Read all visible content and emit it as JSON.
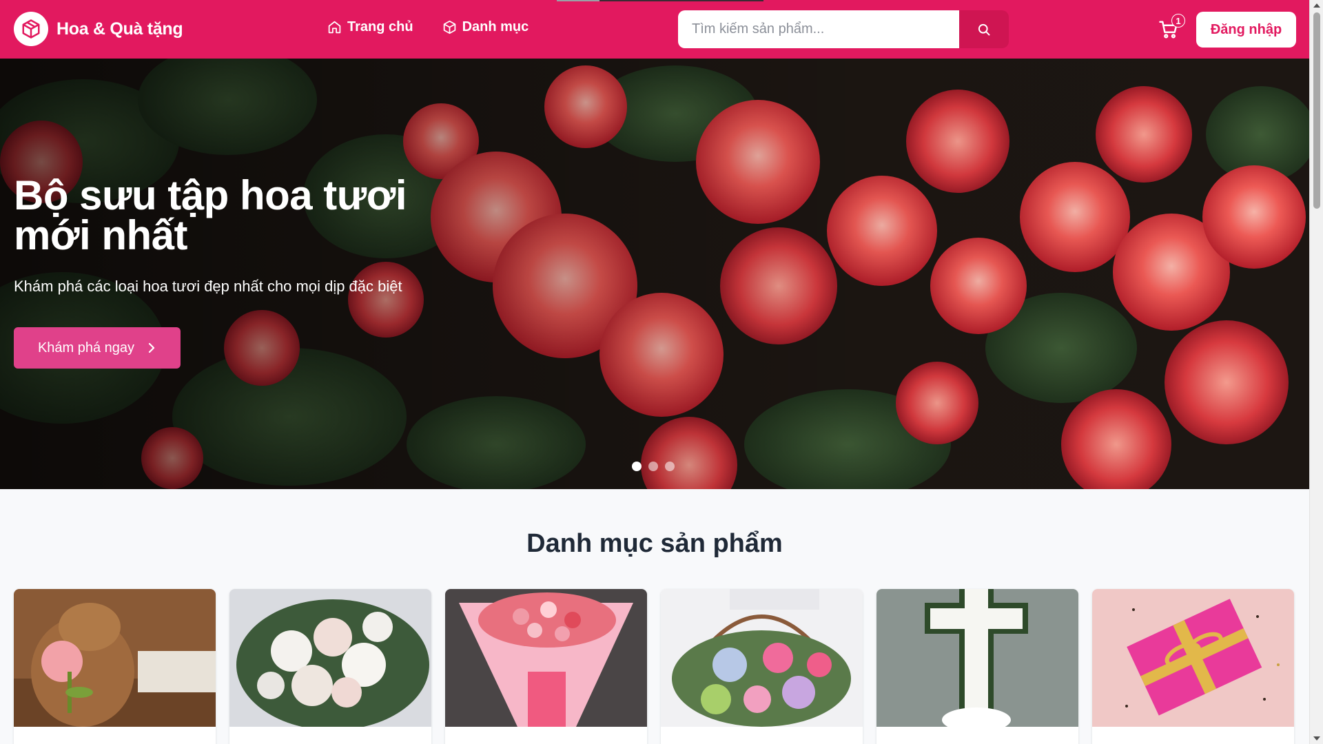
{
  "header": {
    "brand_name": "Hoa & Quà tặng",
    "nav": [
      {
        "label": "Trang chủ",
        "icon": "home-icon"
      },
      {
        "label": "Danh mục",
        "icon": "box-icon"
      }
    ],
    "search_placeholder": "Tìm kiếm sản phẩm...",
    "cart_count": "1",
    "login_label": "Đăng nhập",
    "brand_color": "#e2195f"
  },
  "hero": {
    "title": "Bộ sưu tập hoa tươi mới nhất",
    "subtitle": "Khám phá các loại hoa tươi đẹp nhất cho mọi dịp đặc biệt",
    "cta_label": "Khám phá ngay",
    "slides": 3,
    "active_slide": 1
  },
  "categories": {
    "title": "Danh mục sản phẩm",
    "items": [
      {
        "image": "plush-capybara-with-tulip"
      },
      {
        "image": "white-rose-bouquet"
      },
      {
        "image": "pink-rose-bouquet"
      },
      {
        "image": "flower-basket"
      },
      {
        "image": "white-funeral-cross"
      },
      {
        "image": "pink-gift-box"
      }
    ]
  }
}
